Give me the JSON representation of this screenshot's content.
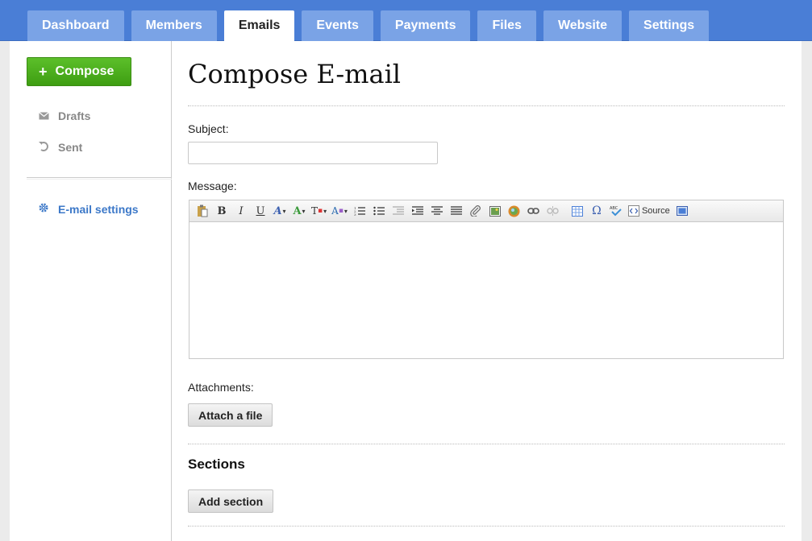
{
  "nav": {
    "tabs": [
      {
        "label": "Dashboard",
        "active": false
      },
      {
        "label": "Members",
        "active": false
      },
      {
        "label": "Emails",
        "active": true
      },
      {
        "label": "Events",
        "active": false
      },
      {
        "label": "Payments",
        "active": false
      },
      {
        "label": "Files",
        "active": false
      },
      {
        "label": "Website",
        "active": false
      },
      {
        "label": "Settings",
        "active": false
      }
    ]
  },
  "sidebar": {
    "compose_label": "Compose",
    "items": [
      {
        "label": "Drafts",
        "icon": "envelope-icon"
      },
      {
        "label": "Sent",
        "icon": "undo-icon"
      },
      {
        "label": "E-mail settings",
        "icon": "gear-icon"
      }
    ]
  },
  "main": {
    "title": "Compose E-mail",
    "subject_label": "Subject:",
    "subject_value": "",
    "message_label": "Message:",
    "toolbar_source_label": "Source",
    "attachments_label": "Attachments:",
    "attach_button": "Attach a file",
    "sections_title": "Sections",
    "add_section_button": "Add section"
  },
  "colors": {
    "nav_bg": "#4a7ed6",
    "tab_inactive": "#7aa3e6",
    "compose_green": "#4caf1e",
    "link_blue": "#3c78c8"
  }
}
